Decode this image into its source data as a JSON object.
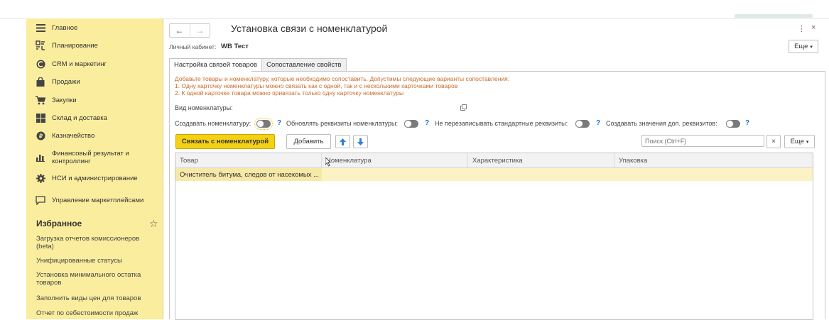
{
  "sidebar": {
    "items": [
      {
        "label": "Главное",
        "icon": "menu-icon"
      },
      {
        "label": "Планирование",
        "icon": "planning-icon"
      },
      {
        "label": "CRM и маркетинг",
        "icon": "crm-icon"
      },
      {
        "label": "Продажи",
        "icon": "shopping-bag-icon"
      },
      {
        "label": "Закупки",
        "icon": "cart-icon"
      },
      {
        "label": "Склад и доставка",
        "icon": "warehouse-icon"
      },
      {
        "label": "Казначейство",
        "icon": "treasury-icon"
      },
      {
        "label": "Финансовый результат и контроллинг",
        "icon": "chart-icon"
      },
      {
        "label": "НСИ и администрирование",
        "icon": "gear-icon"
      },
      {
        "label": "Управление маркетплейсами",
        "icon": "chat-icon"
      }
    ],
    "favorites_title": "Избранное",
    "favorites": [
      "Загрузка отчетов комиссионеров (beta)",
      "Унифицированные статусы",
      "Установка минимального остатка товаров",
      "Заполнить виды цен для товаров",
      "Отчет по себестоимости продаж"
    ]
  },
  "header": {
    "title": "Установка связи с номенклатурой",
    "back": "←",
    "forward": "→",
    "more_glyph": "⋮",
    "close_glyph": "×"
  },
  "cabinet": {
    "label": "Личный кабинет:",
    "value": "WB Тест"
  },
  "more_label": "Еще",
  "tabs": [
    "Настройка связей товаров",
    "Сопоставление свойств"
  ],
  "hints": [
    "Добавьте товары и номенклатуру, которые необходимо сопоставить. Допустимы следующие варианты сопоставления:",
    "1. Одну карточку номенклатуры можно связать как с одной, так и с несколькими карточками товаров",
    "2. К одной карточке товара можно привязать только одну карточку номенклатуры"
  ],
  "kind_label": "Вид номенклатуры:",
  "options": {
    "create_nomenclature": "Создавать номенклатуру:",
    "update_requisites": "Обновлять реквизиты номенклатуры:",
    "no_overwrite": "Не перезаписывать стандартные реквизиты:",
    "create_values": "Создавать значения доп. реквизитов:",
    "help": "?"
  },
  "toolbar": {
    "link_label": "Связать с номенклатурой",
    "add_label": "Добавить",
    "search_placeholder": "Поиск (Ctrl+F)",
    "clear": "×"
  },
  "table": {
    "columns": [
      "Товар",
      "Номенклатура",
      "Характеристика",
      "Упаковка"
    ],
    "rows": [
      [
        "Очиститель битума, следов от насекомых ...",
        "",
        "",
        ""
      ]
    ]
  },
  "colors": {
    "sidebar_bg": "#fbed9e",
    "accent_button": "#f5d014",
    "hint_text": "#c96a2a",
    "help_blue": "#1a6ed8",
    "selected_row": "#fbf3c3"
  }
}
